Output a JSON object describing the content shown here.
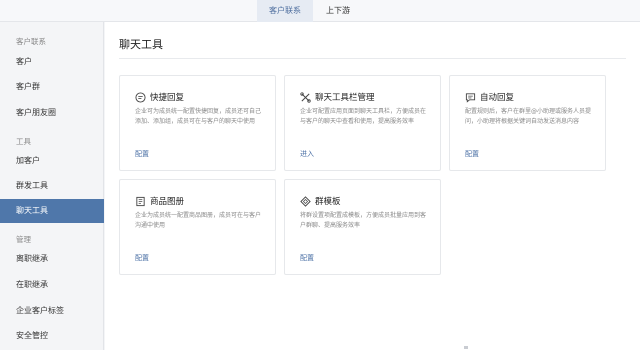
{
  "header": {
    "tabs": [
      {
        "label": "客户联系",
        "active": true
      },
      {
        "label": "上下游",
        "active": false
      }
    ]
  },
  "sidebar": {
    "sections": [
      {
        "title": "客户联系",
        "items": [
          "客户",
          "客户群",
          "客户朋友圈"
        ]
      },
      {
        "title": "工具",
        "items": [
          "加客户",
          "群发工具",
          "聊天工具"
        ]
      },
      {
        "title": "管理",
        "items": [
          "离职继承",
          "在职继承",
          "企业客户标签",
          "安全管控"
        ]
      }
    ],
    "active_item": "聊天工具"
  },
  "main": {
    "title": "聊天工具",
    "cards": [
      {
        "icon": "quick-reply-icon",
        "title": "快捷回复",
        "desc": "企业可为成员统一配置快捷回复，成员还可自己添加、添加组，成员可在与客户的聊天中使用",
        "link": "配置"
      },
      {
        "icon": "toolbar-icon",
        "title": "聊天工具栏管理",
        "desc": "企业可配置应用页面到聊天工具栏，方便成员在与客户的聊天中查看和使用，提高服务效率",
        "link": "进入"
      },
      {
        "icon": "auto-reply-icon",
        "title": "自动回复",
        "desc": "配置规则后，客户在群里@小助理或服务人员提问，小助理将根据关键词自动发送消息内容",
        "link": "配置"
      },
      {
        "icon": "product-album-icon",
        "title": "商品图册",
        "desc": "企业为成员统一配置商品图册，成员可在与客户沟通中使用",
        "link": "配置"
      },
      {
        "icon": "group-template-icon",
        "title": "群模板",
        "desc": "将群设置项配置成模板，方便成员批量应用到客户群聊、提高服务效率",
        "link": "配置"
      }
    ]
  },
  "colors": {
    "accent": "#4f77aa",
    "link": "#4a6fa5",
    "active_tab_bg": "#e6ebf3"
  }
}
